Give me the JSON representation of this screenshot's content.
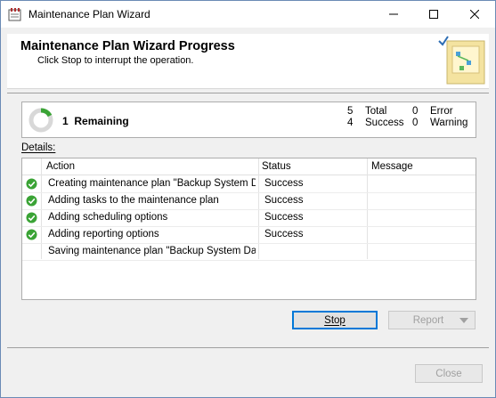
{
  "window": {
    "title": "Maintenance Plan Wizard"
  },
  "header": {
    "title": "Maintenance Plan Wizard Progress",
    "subtitle": "Click Stop to interrupt the operation."
  },
  "progress": {
    "remaining_count": "1",
    "remaining_label": "Remaining",
    "total": "5",
    "total_label": "Total",
    "success": "4",
    "success_label": "Success",
    "error": "0",
    "error_label": "Error",
    "warning": "0",
    "warning_label": "Warning"
  },
  "details": {
    "label": "Details:",
    "columns": [
      "Action",
      "Status",
      "Message"
    ],
    "rows": [
      {
        "action": "Creating maintenance plan \"Backup System D...",
        "status": "Success",
        "message": "",
        "icon": "success-check-icon"
      },
      {
        "action": "Adding tasks to the maintenance plan",
        "status": "Success",
        "message": "",
        "icon": "success-check-icon"
      },
      {
        "action": "Adding scheduling options",
        "status": "Success",
        "message": "",
        "icon": "success-check-icon"
      },
      {
        "action": "Adding reporting options",
        "status": "Success",
        "message": "",
        "icon": "success-check-icon"
      },
      {
        "action": "Saving maintenance plan \"Backup System Da...",
        "status": "",
        "message": "",
        "icon": ""
      }
    ]
  },
  "buttons": {
    "stop": "Stop",
    "report": "Report",
    "close": "Close"
  },
  "colors": {
    "success": "#3aa335",
    "accent": "#0078d7"
  }
}
